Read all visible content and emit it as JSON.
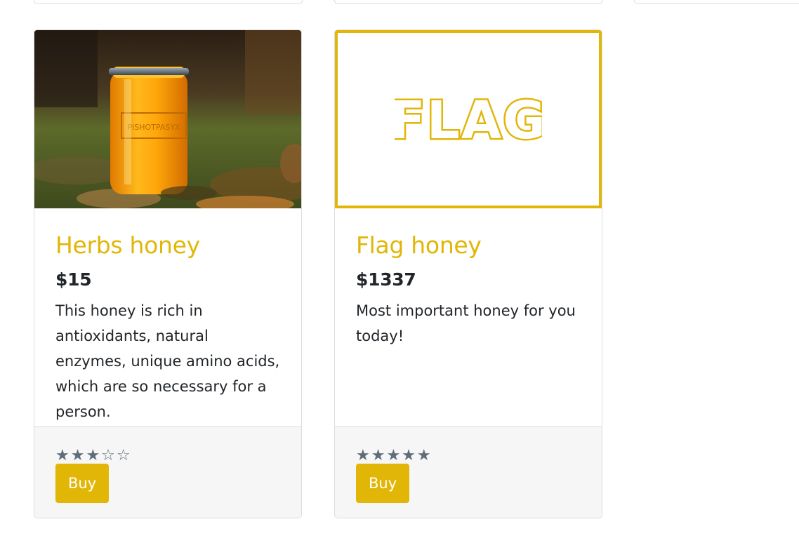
{
  "products": [
    {
      "title": "Herbs honey",
      "price": "$15",
      "description": "This honey is rich in antioxidants, natural enzymes, unique amino acids, which are so necessary for a person.",
      "rating": 3,
      "rating_max": 5,
      "stars_text": "★★★☆☆",
      "buy_label": "Buy",
      "image_label": "PISHOTPASYX"
    },
    {
      "title": "Flag honey",
      "price": "$1337",
      "description": "Most important honey for you today!",
      "rating": 5,
      "rating_max": 5,
      "stars_text": "★★★★★",
      "buy_label": "Buy",
      "image_label": "FLAG"
    }
  ],
  "colors": {
    "accent": "#e2b607",
    "star": "#606c78",
    "footer_bg": "#f6f6f6",
    "border": "#dcdcdc"
  }
}
